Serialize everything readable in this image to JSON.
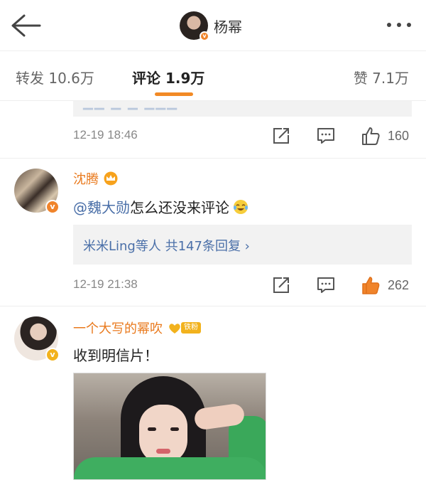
{
  "header": {
    "title": "杨幂",
    "back_icon": "back-arrow-icon",
    "more_icon": "more-dots-icon"
  },
  "tabs": {
    "repost": "转发 10.6万",
    "comment": "评论 1.9万",
    "like": "赞 7.1万",
    "active_color": "#f28a25"
  },
  "comments": [
    {
      "time": "12-19 18:46",
      "likes": "160",
      "liked": false
    },
    {
      "username": "沈腾",
      "mention": "@魏大勋",
      "text": " 怎么还没来评论",
      "reply_summary": "米米Ling等人  共147条回复 ›",
      "time": "12-19 21:38",
      "likes": "262",
      "liked": true
    },
    {
      "username": "一个大写的幂吹",
      "fan_badge": "铁粉",
      "text": "收到明信片！"
    }
  ],
  "colors": {
    "username": "#e9791c",
    "mention": "#4a6fa8",
    "like_active": "#f0842b"
  }
}
